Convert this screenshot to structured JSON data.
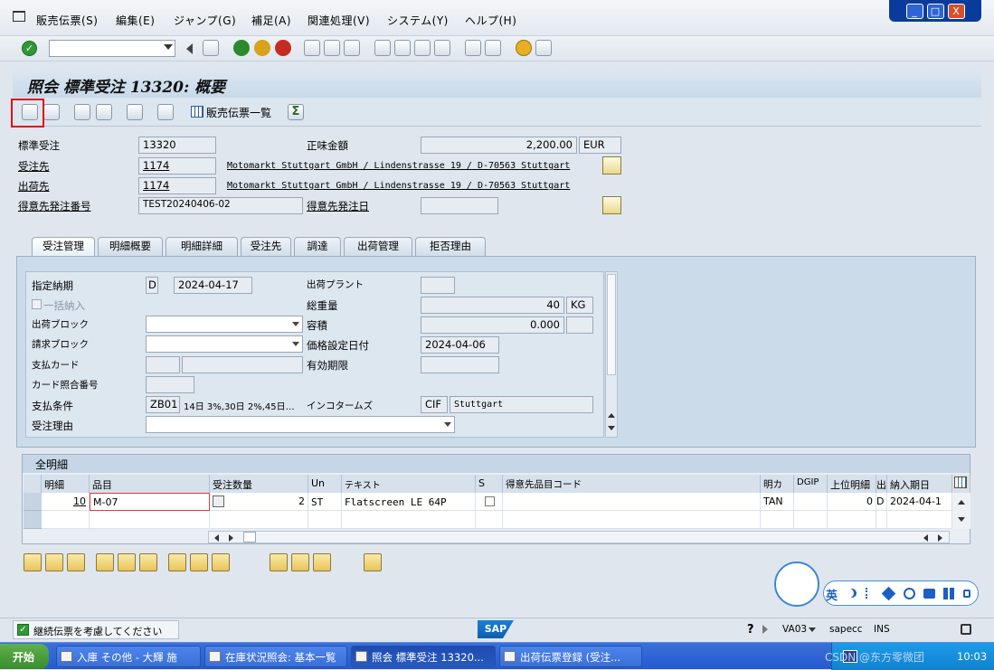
{
  "menu": [
    "販売伝票(S)",
    "編集(E)",
    "ジャンプ(G)",
    "補足(A)",
    "関連処理(V)",
    "システム(Y)",
    "ヘルプ(H)"
  ],
  "window_controls": [
    "_",
    "□",
    "X"
  ],
  "title": "照会 標準受注 13320: 概要",
  "app_toolbar": {
    "list_label": "販売伝票一覧"
  },
  "header": {
    "order_type_label": "標準受注",
    "order_number": "13320",
    "net_value_label": "正味金額",
    "net_value": "2,200.00",
    "currency": "EUR",
    "sold_to_label": "受注先",
    "sold_to": "1174",
    "sold_to_text": "Motomarkt Stuttgart GmbH / Lindenstrasse 19 / D-70563 Stuttgart",
    "ship_to_label": "出荷先",
    "ship_to": "1174",
    "ship_to_text": "Motomarkt Stuttgart GmbH / Lindenstrasse 19 / D-70563 Stuttgart",
    "po_label": "得意先発注番号",
    "po_number": "TEST20240406-02",
    "po_date_label": "得意先発注日",
    "po_date": ""
  },
  "tabs": [
    "受注管理",
    "明細概要",
    "明細詳細",
    "受注先",
    "調達",
    "出荷管理",
    "拒否理由"
  ],
  "sales": {
    "req_delivery_label": "指定納期",
    "req_delivery_type": "D",
    "req_delivery_date": "2024-04-17",
    "plant_label": "出荷プラント",
    "plant": "",
    "complete_delivery_label": "一括納入",
    "total_weight_label": "総重量",
    "total_weight": "40",
    "weight_unit": "KG",
    "delivery_block_label": "出荷ブロック",
    "delivery_block": "",
    "volume_label": "容積",
    "volume": "0.000",
    "volume_unit": "",
    "billing_block_label": "請求ブロック",
    "billing_block": "",
    "pricing_date_label": "価格設定日付",
    "pricing_date": "2024-04-06",
    "payment_card_label": "支払カード",
    "payment_card": "",
    "valid_to_label": "有効期限",
    "valid_to": "",
    "card_verification_label": "カード照合番号",
    "card_verification": "",
    "payment_terms_label": "支払条件",
    "payment_terms": "ZB01",
    "payment_terms_text": "14日 3%,30日 2%,45日…",
    "incoterms_label": "インコタームズ",
    "incoterms": "CIF",
    "incoterms_place": "Stuttgart",
    "order_reason_label": "受注理由",
    "order_reason": ""
  },
  "items_grid": {
    "title": "全明細",
    "columns": [
      "明細",
      "品目",
      "受注数量",
      "Un",
      "テキスト",
      "S",
      "得意先品目コード",
      "明カ",
      "DGIP",
      "上位明細",
      "出",
      "納入期日"
    ],
    "rows": [
      {
        "item": "10",
        "material": "M-07",
        "quantity": "2",
        "unit": "ST",
        "text": "Flatscreen LE 64P",
        "s": "",
        "cust_material": "",
        "category": "TAN",
        "dgip": "",
        "higher_item": "0",
        "out": "D",
        "delivery_date": "2024-04-1"
      }
    ]
  },
  "status": {
    "message": "継続伝票を考慮してください",
    "transaction": "VA03",
    "system": "sapecc",
    "mode": "INS",
    "logo": "SAP"
  },
  "ime": {
    "lang": "英"
  },
  "taskbar": {
    "start": "开始",
    "tasks": [
      "入庫 その他 - 大輝 施",
      "在庫状況照会: 基本一覧",
      "照会 標準受注 13320...",
      "出荷伝票登録 (受注..."
    ],
    "clock": "10:03",
    "watermark": "CSDN @东方零微团"
  }
}
